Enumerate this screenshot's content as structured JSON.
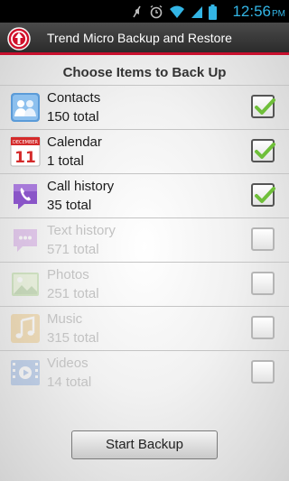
{
  "status_bar": {
    "time": "12:56",
    "ampm": "PM"
  },
  "app": {
    "title": "Trend Micro Backup and Restore",
    "accent_color": "#c8102e"
  },
  "heading": "Choose Items to Back Up",
  "items": [
    {
      "label": "Contacts",
      "count": "150 total",
      "checked": true,
      "enabled": true,
      "icon": "contacts-icon"
    },
    {
      "label": "Calendar",
      "count": "1 total",
      "checked": true,
      "enabled": true,
      "icon": "calendar-icon",
      "icon_month": "DECEMBER",
      "icon_day": "11"
    },
    {
      "label": "Call history",
      "count": "35 total",
      "checked": true,
      "enabled": true,
      "icon": "phone-icon"
    },
    {
      "label": "Text history",
      "count": "571 total",
      "checked": false,
      "enabled": false,
      "icon": "message-icon"
    },
    {
      "label": "Photos",
      "count": "251 total",
      "checked": false,
      "enabled": false,
      "icon": "photo-icon"
    },
    {
      "label": "Music",
      "count": "315 total",
      "checked": false,
      "enabled": false,
      "icon": "music-icon"
    },
    {
      "label": "Videos",
      "count": "14 total",
      "checked": false,
      "enabled": false,
      "icon": "video-icon"
    }
  ],
  "button": {
    "label": "Start Backup"
  }
}
